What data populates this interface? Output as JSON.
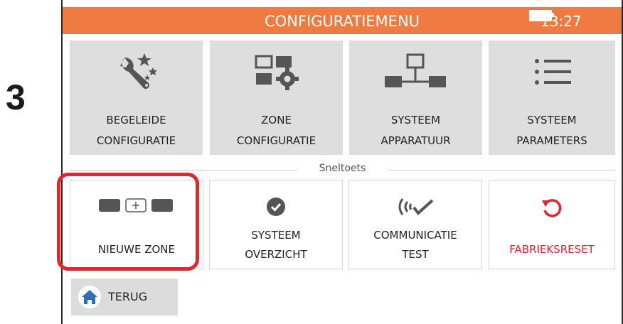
{
  "step_number": "3",
  "header": {
    "title": "CONFIGURATIEMENU",
    "time": "13:27",
    "battery_icon": "battery-icon",
    "bar_color": "#ef7a42"
  },
  "main_tiles": [
    {
      "line1": "BEGELEIDE",
      "line2": "CONFIGURATIE",
      "icon": "wizard-tools-icon"
    },
    {
      "line1": "ZONE",
      "line2": "CONFIGURATIE",
      "icon": "zone-settings-icon"
    },
    {
      "line1": "SYSTEEM",
      "line2": "APPARATUUR",
      "icon": "network-devices-icon"
    },
    {
      "line1": "SYSTEEM",
      "line2": "PARAMETERS",
      "icon": "list-icon"
    }
  ],
  "shortcut_title": "Sneltoets",
  "shortcuts": [
    {
      "line1": "NIEUWE ZONE",
      "icon": "add-zone-icon"
    },
    {
      "line1": "SYSTEEM",
      "line2": "OVERZICHT",
      "icon": "check-circle-icon"
    },
    {
      "line1": "COMMUNICATIE",
      "line2": "TEST",
      "icon": "signal-hand-icon"
    },
    {
      "line1": "FABRIEKSRESET",
      "icon": "reset-icon",
      "color": "#e8232b"
    }
  ],
  "back": {
    "label": "TERUG",
    "icon": "home-icon",
    "icon_color": "#2d6fb5"
  },
  "highlight_color": "#e8232b"
}
